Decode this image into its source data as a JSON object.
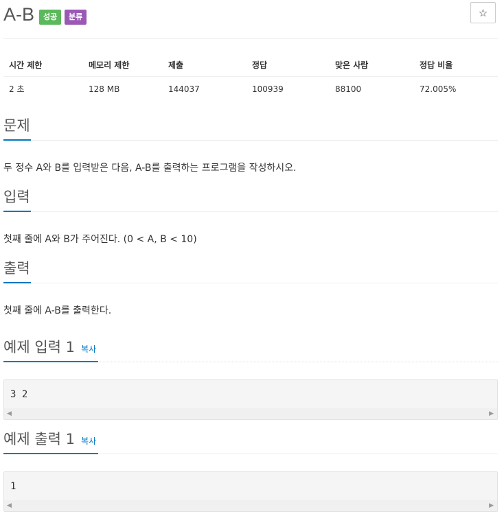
{
  "problem": {
    "title": "A-B",
    "badges": {
      "success": "성공",
      "category": "분류"
    },
    "star_icon": "☆"
  },
  "stats": {
    "headers": [
      "시간 제한",
      "메모리 제한",
      "제출",
      "정답",
      "맞은 사람",
      "정답 비율"
    ],
    "values": [
      "2 초",
      "128 MB",
      "144037",
      "100939",
      "88100",
      "72.005%"
    ]
  },
  "sections": {
    "problem": {
      "title": "문제",
      "text": "두 정수 A와 B를 입력받은 다음, A-B를 출력하는 프로그램을 작성하시오."
    },
    "input": {
      "title": "입력",
      "text": "첫째 줄에 A와 B가 주어진다. (0 < A, B < 10)"
    },
    "output": {
      "title": "출력",
      "text": "첫째 줄에 A-B를 출력한다."
    }
  },
  "samples": {
    "input_title": "예제 입력 1",
    "input_copy": "복사",
    "input_value": "3 2",
    "output_title": "예제 출력 1",
    "output_copy": "복사",
    "output_value": "1"
  },
  "colors": {
    "accent": "#0076c0",
    "success": "#5cb85c",
    "category": "#9b59b6"
  }
}
